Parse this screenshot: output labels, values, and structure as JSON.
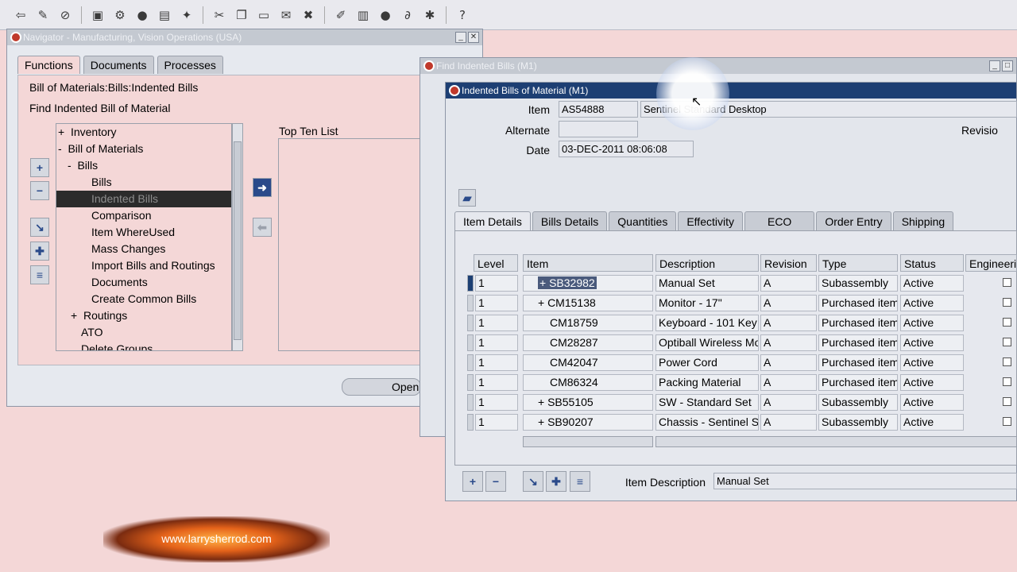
{
  "toolbar": {
    "icons": [
      "back-icon",
      "flashlight-icon",
      "globe-icon",
      "folder-icon",
      "gear-icon",
      "gear-icon",
      "printer-icon",
      "edit-icon",
      "cut-icon",
      "copy-icon",
      "paste-icon",
      "clear-icon",
      "delete-icon",
      "attachment-icon",
      "translation-icon",
      "help-icon"
    ]
  },
  "navigator": {
    "title": "Navigator - Manufacturing, Vision Operations (USA)",
    "tabs": [
      "Functions",
      "Documents",
      "Processes"
    ],
    "path": "Bill of Materials:Bills:Indented Bills",
    "subtitle": "Find Indented Bill of Material",
    "top_ten_label": "Top Ten List",
    "open_button": "Open",
    "tree": [
      {
        "prefix": "+",
        "label": "Inventory",
        "indent": 0
      },
      {
        "prefix": "-",
        "label": "Bill of Materials",
        "indent": 0
      },
      {
        "prefix": "-",
        "label": "Bills",
        "indent": 1
      },
      {
        "prefix": "",
        "label": "Bills",
        "indent": 2
      },
      {
        "prefix": "",
        "label": "Indented Bills",
        "indent": 2,
        "selected": true
      },
      {
        "prefix": "",
        "label": "Comparison",
        "indent": 2
      },
      {
        "prefix": "",
        "label": "Item WhereUsed",
        "indent": 2
      },
      {
        "prefix": "",
        "label": "Mass Changes",
        "indent": 2
      },
      {
        "prefix": "",
        "label": "Import Bills and Routings",
        "indent": 2
      },
      {
        "prefix": "",
        "label": "Documents",
        "indent": 2
      },
      {
        "prefix": "",
        "label": "Create Common Bills",
        "indent": 2
      },
      {
        "prefix": "+",
        "label": "Routings",
        "indent": 1
      },
      {
        "prefix": "",
        "label": "ATO",
        "indent": 1
      },
      {
        "prefix": "",
        "label": "Delete Groups",
        "indent": 1
      }
    ]
  },
  "find_window": {
    "title": "Find Indented Bills (M1)"
  },
  "indented_window": {
    "title": "Indented Bills of Material (M1)",
    "item_label": "Item",
    "item_value": "AS54888",
    "item_desc": "Sentinel Standard Desktop",
    "alternate_label": "Alternate",
    "alternate_value": "",
    "revision_label": "Revisio",
    "date_label": "Date",
    "date_value": "03-DEC-2011 08:06:08",
    "tabs": [
      "Item Details",
      "Bills Details",
      "Quantities",
      "Effectivity",
      "ECO",
      "Order Entry",
      "Shipping"
    ],
    "columns": [
      "Level",
      "Item",
      "Description",
      "Revision",
      "Type",
      "Status",
      "Engineerin"
    ],
    "rows": [
      {
        "level": "1",
        "item": "+ SB32982",
        "description": "Manual Set",
        "revision": "A",
        "type": "Subassembly",
        "status": "Active"
      },
      {
        "level": "1",
        "item": "+ CM15138",
        "description": "Monitor - 17\"",
        "revision": "A",
        "type": "Purchased item",
        "status": "Active"
      },
      {
        "level": "1",
        "item": "CM18759",
        "description": "Keyboard - 101 Key",
        "revision": "A",
        "type": "Purchased item",
        "status": "Active"
      },
      {
        "level": "1",
        "item": "CM28287",
        "description": "Optiball Wireless Mo",
        "revision": "A",
        "type": "Purchased item",
        "status": "Active"
      },
      {
        "level": "1",
        "item": "CM42047",
        "description": "Power Cord",
        "revision": "A",
        "type": "Purchased item",
        "status": "Active"
      },
      {
        "level": "1",
        "item": "CM86324",
        "description": "Packing Material",
        "revision": "A",
        "type": "Purchased item",
        "status": "Active"
      },
      {
        "level": "1",
        "item": "+ SB55105",
        "description": "SW - Standard Set",
        "revision": "A",
        "type": "Subassembly",
        "status": "Active"
      },
      {
        "level": "1",
        "item": "+ SB90207",
        "description": "Chassis - Sentinel S",
        "revision": "A",
        "type": "Subassembly",
        "status": "Active"
      }
    ],
    "item_description_label": "Item Description",
    "item_description_value": "Manual Set"
  },
  "watermark": "www.larrysherrod.com"
}
